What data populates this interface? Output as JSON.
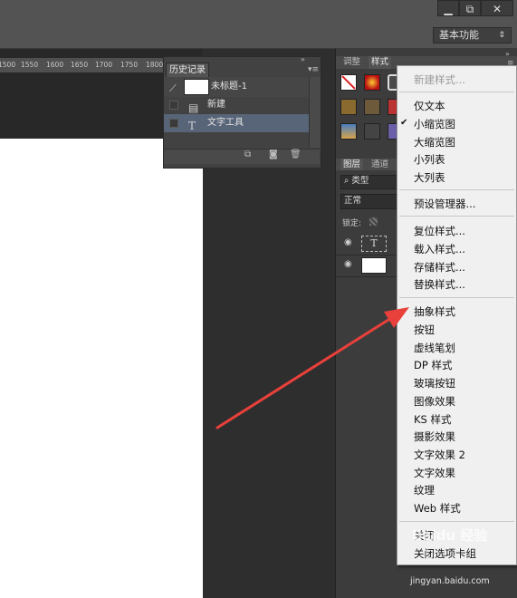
{
  "window": {
    "minimize": "▁",
    "restore": "⧉",
    "close": "✕"
  },
  "options_bar": {
    "workspace": "基本功能"
  },
  "ruler": {
    "ticks": [
      "1500",
      "1550",
      "1600",
      "1650",
      "1700",
      "1750",
      "1800"
    ]
  },
  "history_panel": {
    "tab": "历史记录",
    "snapshot": "未标题-1",
    "items": [
      {
        "label": "新建",
        "icon": "document-icon"
      },
      {
        "label": "文字工具",
        "icon": "text-tool-icon"
      }
    ]
  },
  "styles_panel": {
    "tabs": [
      "调整",
      "样式"
    ]
  },
  "layers_panel": {
    "tabs": [
      "图层",
      "通道"
    ],
    "filter": "类型",
    "blend_mode": "正常",
    "lock_label": "锁定:"
  },
  "menu": {
    "new_style": "新建样式...",
    "view": [
      "仅文本",
      "小缩览图",
      "大缩览图",
      "小列表",
      "大列表"
    ],
    "checked_view": "小缩览图",
    "preset_manager": "预设管理器...",
    "file_ops": [
      "复位样式...",
      "载入样式...",
      "存储样式...",
      "替换样式..."
    ],
    "libraries": [
      "抽象样式",
      "按钮",
      "虚线笔划",
      "DP 样式",
      "玻璃按钮",
      "图像效果",
      "KS 样式",
      "摄影效果",
      "文字效果 2",
      "文字效果",
      "纹理",
      "Web 样式"
    ],
    "close": "关闭",
    "close_group": "关闭选项卡组"
  },
  "watermark": {
    "brand": "Baidu 经验",
    "url": "jingyan.baidu.com"
  },
  "colors": {
    "annotation_arrow": "#e8403a",
    "menu_bg": "#f0f0f0",
    "ui_dark": "#535353"
  }
}
